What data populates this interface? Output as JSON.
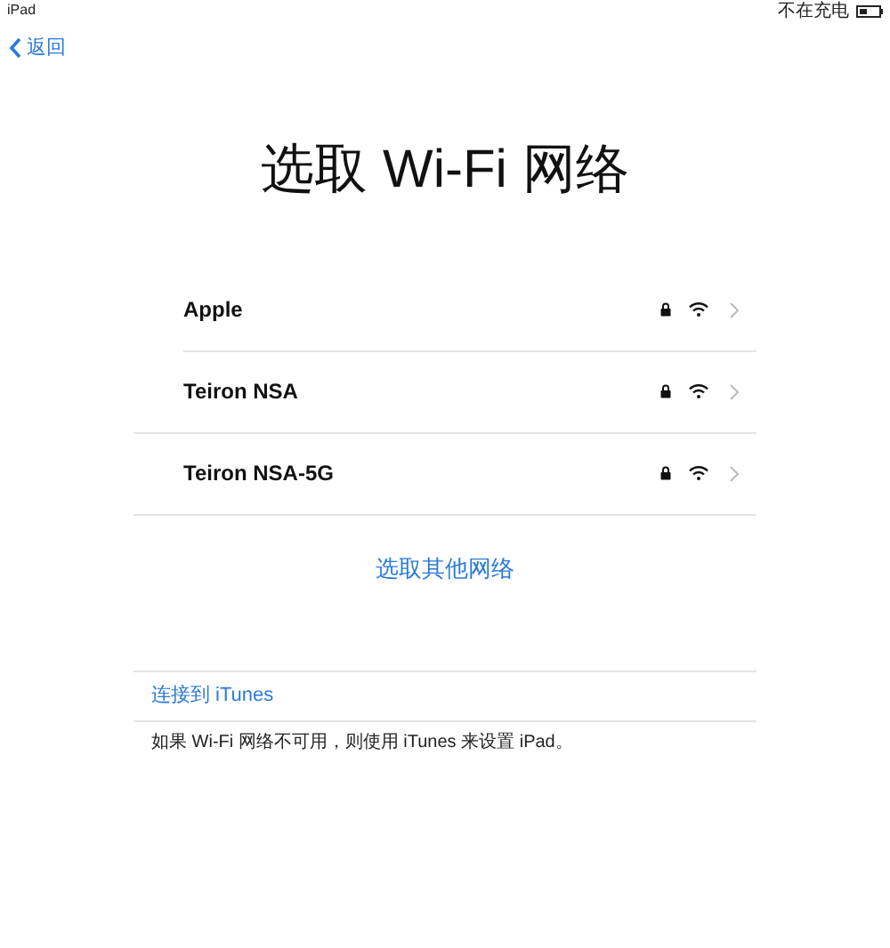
{
  "status_bar": {
    "device": "iPad",
    "charging_text": "不在充电"
  },
  "back_button": {
    "label": "返回"
  },
  "title": "选取 Wi-Fi 网络",
  "networks": [
    {
      "name": "Apple",
      "locked": true
    },
    {
      "name": "Teiron NSA",
      "locked": true
    },
    {
      "name": "Teiron NSA-5G",
      "locked": true
    }
  ],
  "other_network_link": "选取其他网络",
  "itunes": {
    "link": "连接到 iTunes",
    "note": "如果 Wi-Fi 网络不可用，则使用 iTunes 来设置 iPad。"
  }
}
